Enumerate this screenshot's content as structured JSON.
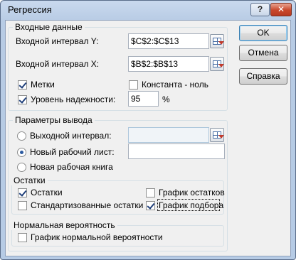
{
  "window": {
    "title": "Регрессия",
    "help_label": "?",
    "close_label": "✕"
  },
  "input": {
    "group_label": "Входные данные",
    "y_label": "Входной интервал Y:",
    "y_value": "$C$2:$C$13",
    "x_label": "Входной интервал X:",
    "x_value": "$B$2:$B$13",
    "labels_label": "Метки",
    "labels_checked": true,
    "constant_label": "Константа - ноль",
    "constant_checked": false,
    "confidence_label": "Уровень надежности:",
    "confidence_checked": true,
    "confidence_value": "95",
    "percent": "%"
  },
  "output": {
    "group_label": "Параметры вывода",
    "output_range_label": "Выходной интервал:",
    "output_range_value": "",
    "new_sheet_label": "Новый рабочий лист:",
    "new_sheet_value": "",
    "new_book_label": "Новая рабочая книга",
    "selected": "new_sheet"
  },
  "residuals": {
    "group_label": "Остатки",
    "residuals_label": "Остатки",
    "residuals_checked": true,
    "std_residuals_label": "Стандартизованные остатки",
    "std_residuals_checked": false,
    "residual_plot_label": "График остатков",
    "residual_plot_checked": false,
    "fit_plot_label": "График подбора",
    "fit_plot_checked": true
  },
  "normal": {
    "group_label": "Нормальная вероятность",
    "normal_plot_label": "График нормальной вероятности",
    "normal_plot_checked": false
  },
  "buttons": {
    "ok": "OK",
    "cancel": "Отмена",
    "help": "Справка"
  },
  "icons": {
    "ref": "range-select-icon",
    "check": "check-icon",
    "radio": "radio-dot-icon"
  }
}
